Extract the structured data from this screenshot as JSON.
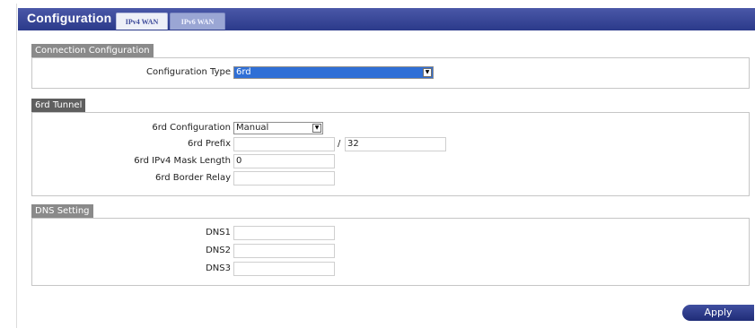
{
  "header": {
    "title": "Configuration",
    "tabs": [
      {
        "label": "IPv4 WAN",
        "active": true
      },
      {
        "label": "IPv6 WAN",
        "active": false
      }
    ]
  },
  "sections": {
    "connection": {
      "title": "Connection Configuration",
      "config_type_label": "Configuration Type",
      "config_type_value": "6rd"
    },
    "tunnel": {
      "title": "6rd Tunnel",
      "config_label": "6rd Configuration",
      "config_value": "Manual",
      "prefix_label": "6rd Prefix",
      "prefix_value": "",
      "prefix_separator": "/",
      "prefix_len_value": "32",
      "mask_label": "6rd IPv4 Mask Length",
      "mask_value": "0",
      "relay_label": "6rd Border Relay",
      "relay_value": ""
    },
    "dns": {
      "title": "DNS Setting",
      "dns1_label": "DNS1",
      "dns1_value": "",
      "dns2_label": "DNS2",
      "dns2_value": "",
      "dns3_label": "DNS3",
      "dns3_value": ""
    }
  },
  "footer": {
    "apply_label": "Apply"
  },
  "colors": {
    "header_bar": "#2b3a8a",
    "section_header": "#8a8a8a",
    "selection_highlight": "#2f6fd6"
  }
}
